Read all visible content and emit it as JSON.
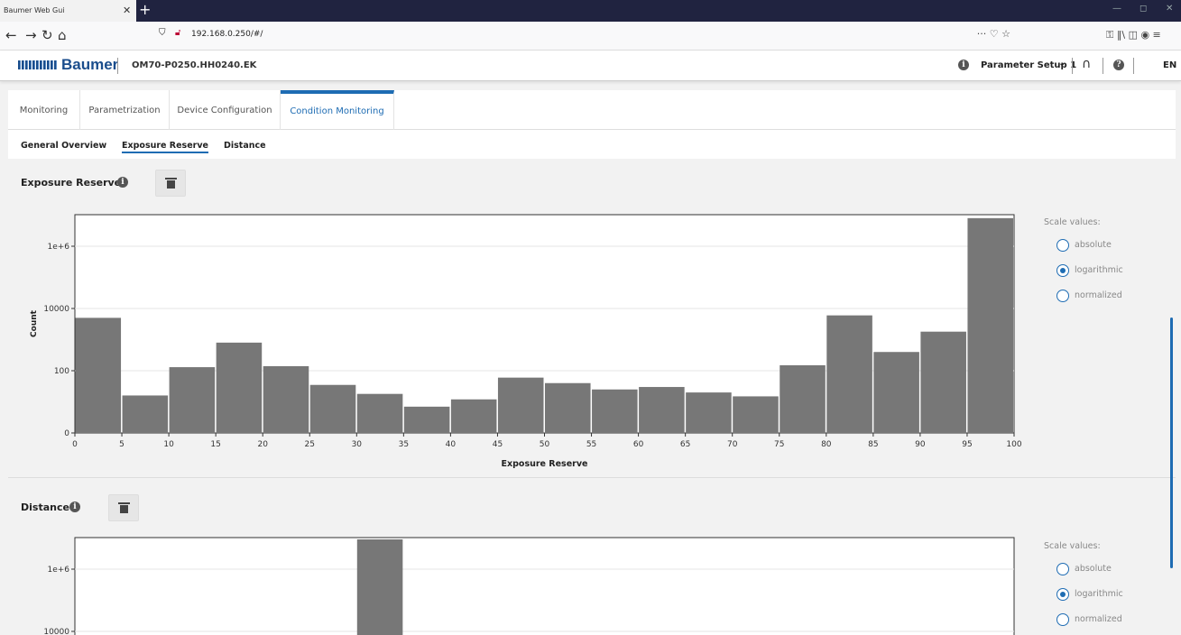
{
  "browser": {
    "tab_title": "Baumer Web Gui",
    "tab_close": "✕",
    "new_tab": "+",
    "url": "192.168.0.250/#/",
    "url_right_icons": "··· ♡ ☆",
    "toolbar_right": "⚿ ‖\\ ◫ ◉ ≡",
    "back": "←",
    "forward": "→",
    "reload": "↻",
    "home": "⌂",
    "minimize": "—",
    "restore": "◻",
    "close": "✕"
  },
  "header": {
    "brand": "Baumer",
    "device_name": "OM70-P0250.HH0240.EK",
    "info_glyph": "i",
    "parameter_setup": "Parameter Setup 1",
    "parameter_chevron": "⌄",
    "headset_glyph": "∩",
    "help_glyph": "?",
    "language": "EN"
  },
  "main_tabs": [
    {
      "label": "Monitoring",
      "active": false
    },
    {
      "label": "Parametrization",
      "active": false
    },
    {
      "label": "Device Configuration",
      "active": false
    },
    {
      "label": "Condition Monitoring",
      "active": true
    }
  ],
  "sub_tabs": [
    {
      "label": "General Overview",
      "active": false
    },
    {
      "label": "Exposure Reserve",
      "active": true
    },
    {
      "label": "Distance",
      "active": false
    }
  ],
  "sections": {
    "exposure": {
      "title": "Exposure Reserve",
      "scale_title": "Scale values:",
      "options": [
        {
          "label": "absolute",
          "checked": false
        },
        {
          "label": "logarithmic",
          "checked": true
        },
        {
          "label": "normalized",
          "checked": false
        }
      ]
    },
    "distance": {
      "title": "Distance",
      "scale_title": "Scale values:",
      "options": [
        {
          "label": "absolute",
          "checked": false
        },
        {
          "label": "logarithmic",
          "checked": true
        },
        {
          "label": "normalized",
          "checked": false
        }
      ]
    }
  },
  "chart_data": [
    {
      "type": "bar",
      "title": "",
      "xlabel": "Exposure Reserve",
      "ylabel": "Count",
      "y_scale": "log",
      "y_tick_labels": [
        "0",
        "100",
        "10000",
        "1e+6"
      ],
      "x_tick_labels": [
        "0",
        "5",
        "10",
        "15",
        "20",
        "25",
        "30",
        "35",
        "40",
        "45",
        "50",
        "55",
        "60",
        "65",
        "70",
        "75",
        "80",
        "85",
        "90",
        "95",
        "100"
      ],
      "bin_width": 5,
      "xlim": [
        0,
        100
      ],
      "bins": [
        0,
        5,
        10,
        15,
        20,
        25,
        30,
        35,
        40,
        45,
        50,
        55,
        60,
        65,
        70,
        75,
        80,
        85,
        90,
        95
      ],
      "values": [
        5000,
        16,
        130,
        800,
        140,
        35,
        18,
        7,
        12,
        60,
        40,
        25,
        30,
        20,
        15,
        150,
        6000,
        400,
        1800,
        8000000
      ],
      "bar_color": "#777777"
    },
    {
      "type": "bar",
      "title": "",
      "xlabel": "",
      "ylabel": "",
      "y_scale": "log",
      "y_tick_labels": [
        "10000",
        "1e+6"
      ],
      "bins_visible": [
        30
      ],
      "values": [
        8000000
      ],
      "bar_color": "#777777"
    }
  ]
}
